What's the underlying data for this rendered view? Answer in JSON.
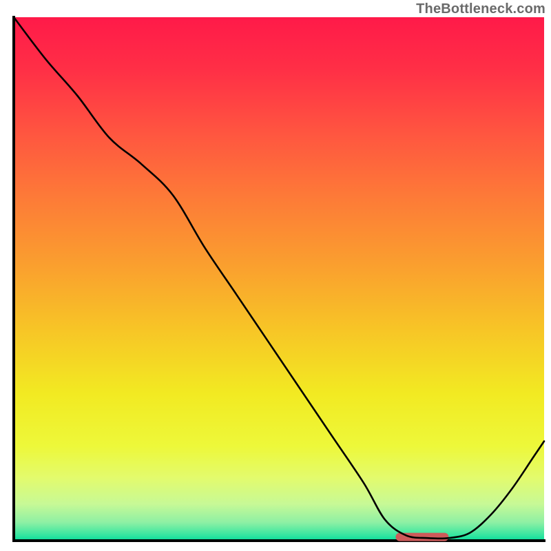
{
  "watermark": "TheBottleneck.com",
  "chart_data": {
    "type": "line",
    "title": "",
    "xlabel": "",
    "ylabel": "",
    "xlim": [
      0,
      100
    ],
    "ylim": [
      0,
      100
    ],
    "grid": false,
    "legend": false,
    "annotations": [],
    "series": [
      {
        "name": "curve",
        "x": [
          0,
          6,
          12,
          18,
          24,
          30,
          36,
          42,
          48,
          54,
          60,
          66,
          70,
          74,
          78,
          82,
          86,
          90,
          94,
          98,
          100
        ],
        "y": [
          100,
          92,
          85,
          77,
          72,
          66,
          56,
          47,
          38,
          29,
          20,
          11,
          4,
          1,
          0.5,
          0.5,
          1.5,
          5,
          10,
          16,
          19
        ]
      }
    ],
    "marker": {
      "name": "optimal-zone",
      "x_start": 72,
      "x_end": 82,
      "y": 0.7,
      "color": "#cd5a5a"
    },
    "background_gradient": {
      "stops": [
        {
          "offset": 0.0,
          "color": "#ff1a49"
        },
        {
          "offset": 0.1,
          "color": "#ff2f46"
        },
        {
          "offset": 0.22,
          "color": "#ff5540"
        },
        {
          "offset": 0.35,
          "color": "#fd7c37"
        },
        {
          "offset": 0.48,
          "color": "#faa12e"
        },
        {
          "offset": 0.6,
          "color": "#f7c626"
        },
        {
          "offset": 0.72,
          "color": "#f2ea22"
        },
        {
          "offset": 0.82,
          "color": "#edf83a"
        },
        {
          "offset": 0.88,
          "color": "#e3fb6d"
        },
        {
          "offset": 0.93,
          "color": "#c7f996"
        },
        {
          "offset": 0.965,
          "color": "#8ef0a4"
        },
        {
          "offset": 0.99,
          "color": "#33e6a0"
        },
        {
          "offset": 1.0,
          "color": "#07dc9a"
        }
      ]
    },
    "axis_color": "#000000",
    "line_color": "#000000",
    "line_width": 2.6
  }
}
